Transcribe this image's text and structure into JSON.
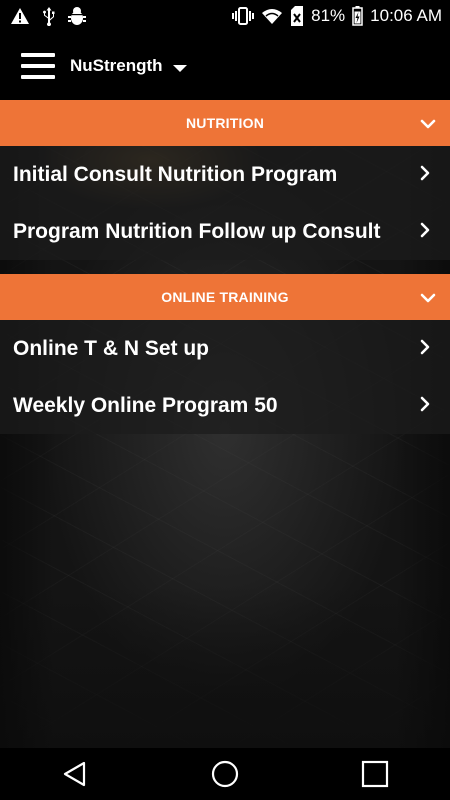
{
  "status_bar": {
    "battery": "81%",
    "time": "10:06 AM"
  },
  "app_bar": {
    "title": "NuStrength"
  },
  "sections": [
    {
      "title": "NUTRITION",
      "items": [
        {
          "label": "Initial Consult Nutrition Program"
        },
        {
          "label": "Program Nutrition Follow up Consult"
        }
      ]
    },
    {
      "title": "ONLINE TRAINING",
      "items": [
        {
          "label": "Online T & N Set up"
        },
        {
          "label": "Weekly Online Program 50"
        }
      ]
    }
  ],
  "colors": {
    "accent": "#ee7437",
    "background": "#151515"
  },
  "icons": {
    "status_left": [
      "warning-icon",
      "usb-icon",
      "android-debug-icon"
    ],
    "status_right": [
      "vibrate-icon",
      "wifi-icon",
      "no-sim-icon",
      "battery-icon"
    ],
    "nav": [
      "back-icon",
      "home-icon",
      "recents-icon"
    ]
  }
}
